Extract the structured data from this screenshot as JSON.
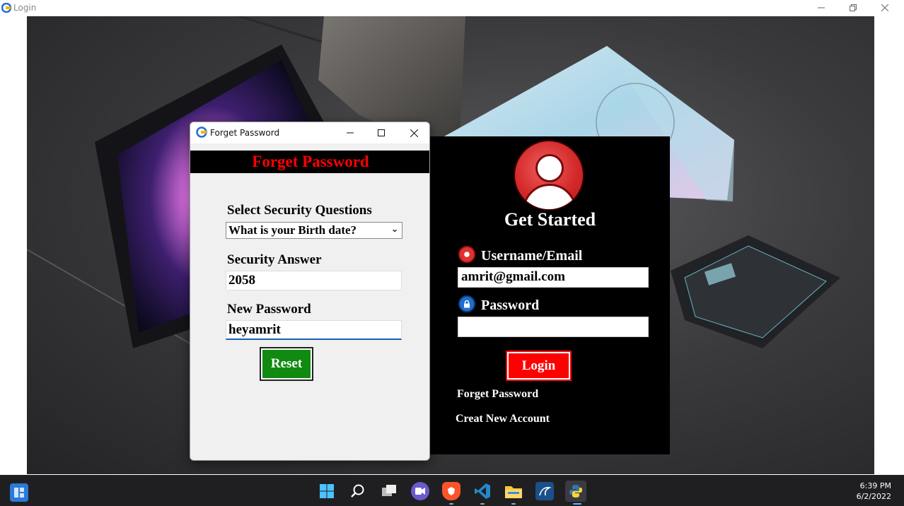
{
  "main_window": {
    "title": "Login"
  },
  "login": {
    "heading": "Get Started",
    "username_label": "Username/Email",
    "username_value": "amrit@gmail.com",
    "password_label": "Password",
    "password_value": "",
    "login_button": "Login",
    "forgot_link": "Forget Password",
    "create_link": "Creat New Account",
    "colors": {
      "panel": "#000000",
      "button": "#ff0000"
    }
  },
  "forget_dialog": {
    "window_title": "Forget Password",
    "header": "Forget Password",
    "security_question_label": "Select Security Questions",
    "security_question_value": "What is your Birth date?",
    "security_answer_label": "Security Answer",
    "security_answer_value": "2058",
    "new_password_label": "New Password",
    "new_password_value": "heyamrit",
    "reset_button": "Reset",
    "colors": {
      "header_text": "#ff0000",
      "reset_button": "#108a10"
    }
  },
  "taskbar": {
    "time": "6:39 PM",
    "date": "6/2/2022"
  }
}
